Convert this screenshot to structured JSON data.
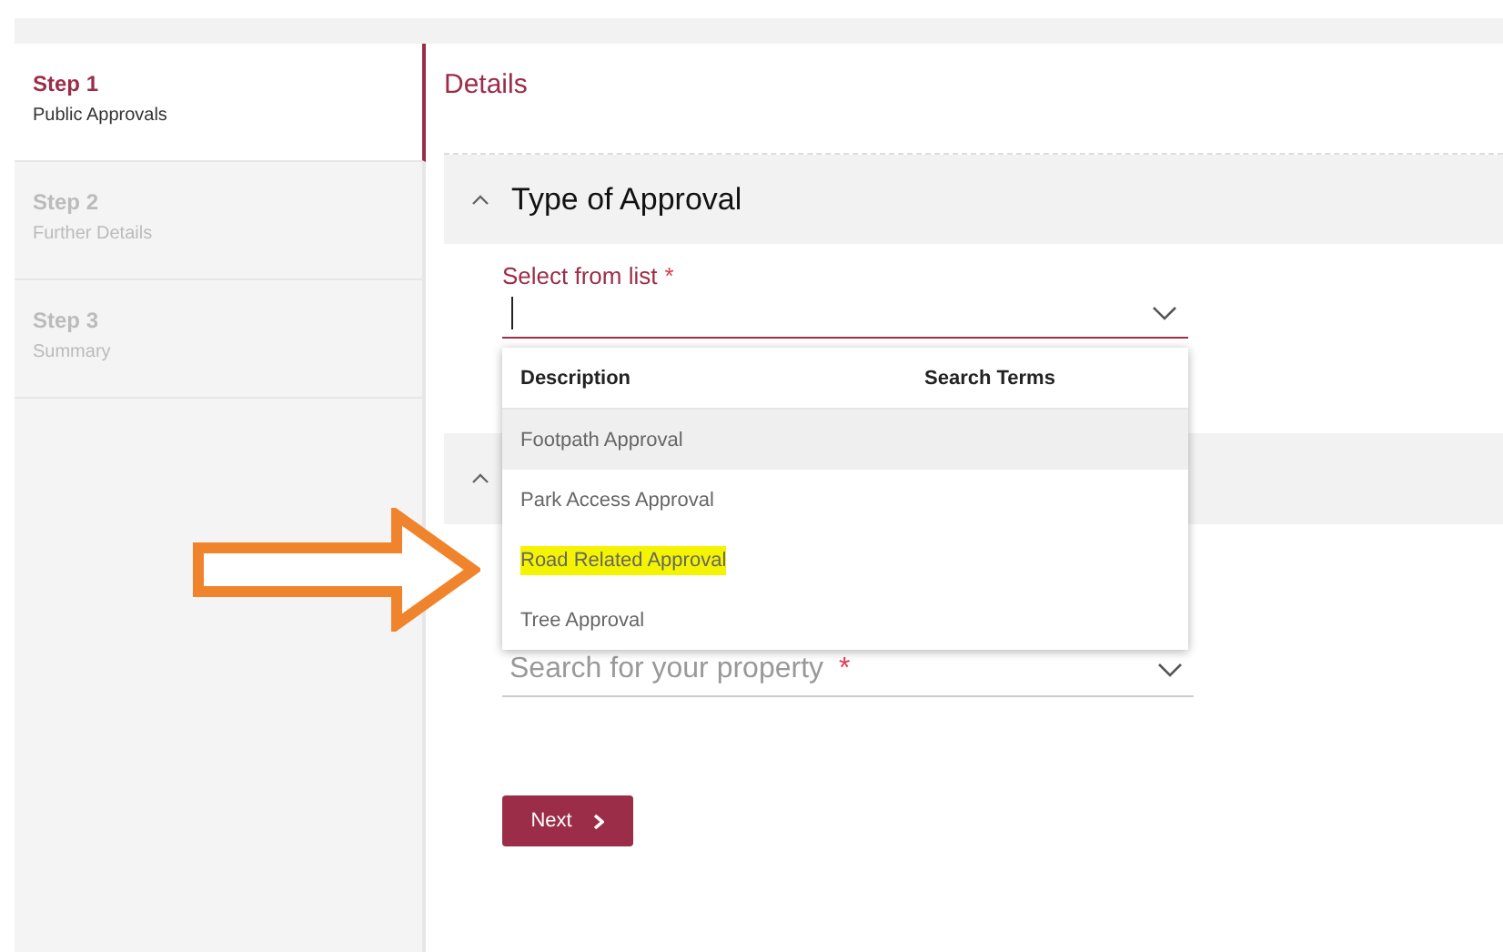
{
  "steps": [
    {
      "title": "Step 1",
      "subtitle": "Public Approvals",
      "selected": true
    },
    {
      "title": "Step 2",
      "subtitle": "Further Details",
      "selected": false
    },
    {
      "title": "Step 3",
      "subtitle": "Summary",
      "selected": false
    }
  ],
  "page_title": "Details",
  "section": {
    "title": "Type of Approval",
    "expanded": true
  },
  "select": {
    "label": "Select from list",
    "required": "*"
  },
  "dropdown": {
    "columns": [
      "Description",
      "Search Terms"
    ],
    "options": [
      {
        "label": "Footpath Approval",
        "hovered": true,
        "highlighted": false
      },
      {
        "label": "Park Access Approval",
        "hovered": false,
        "highlighted": false
      },
      {
        "label": "Road Related Approval",
        "hovered": false,
        "highlighted": true
      },
      {
        "label": "Tree Approval",
        "hovered": false,
        "highlighted": false
      }
    ]
  },
  "property_field": {
    "placeholder": "Search for your property",
    "required": "*"
  },
  "next_button": "Next"
}
